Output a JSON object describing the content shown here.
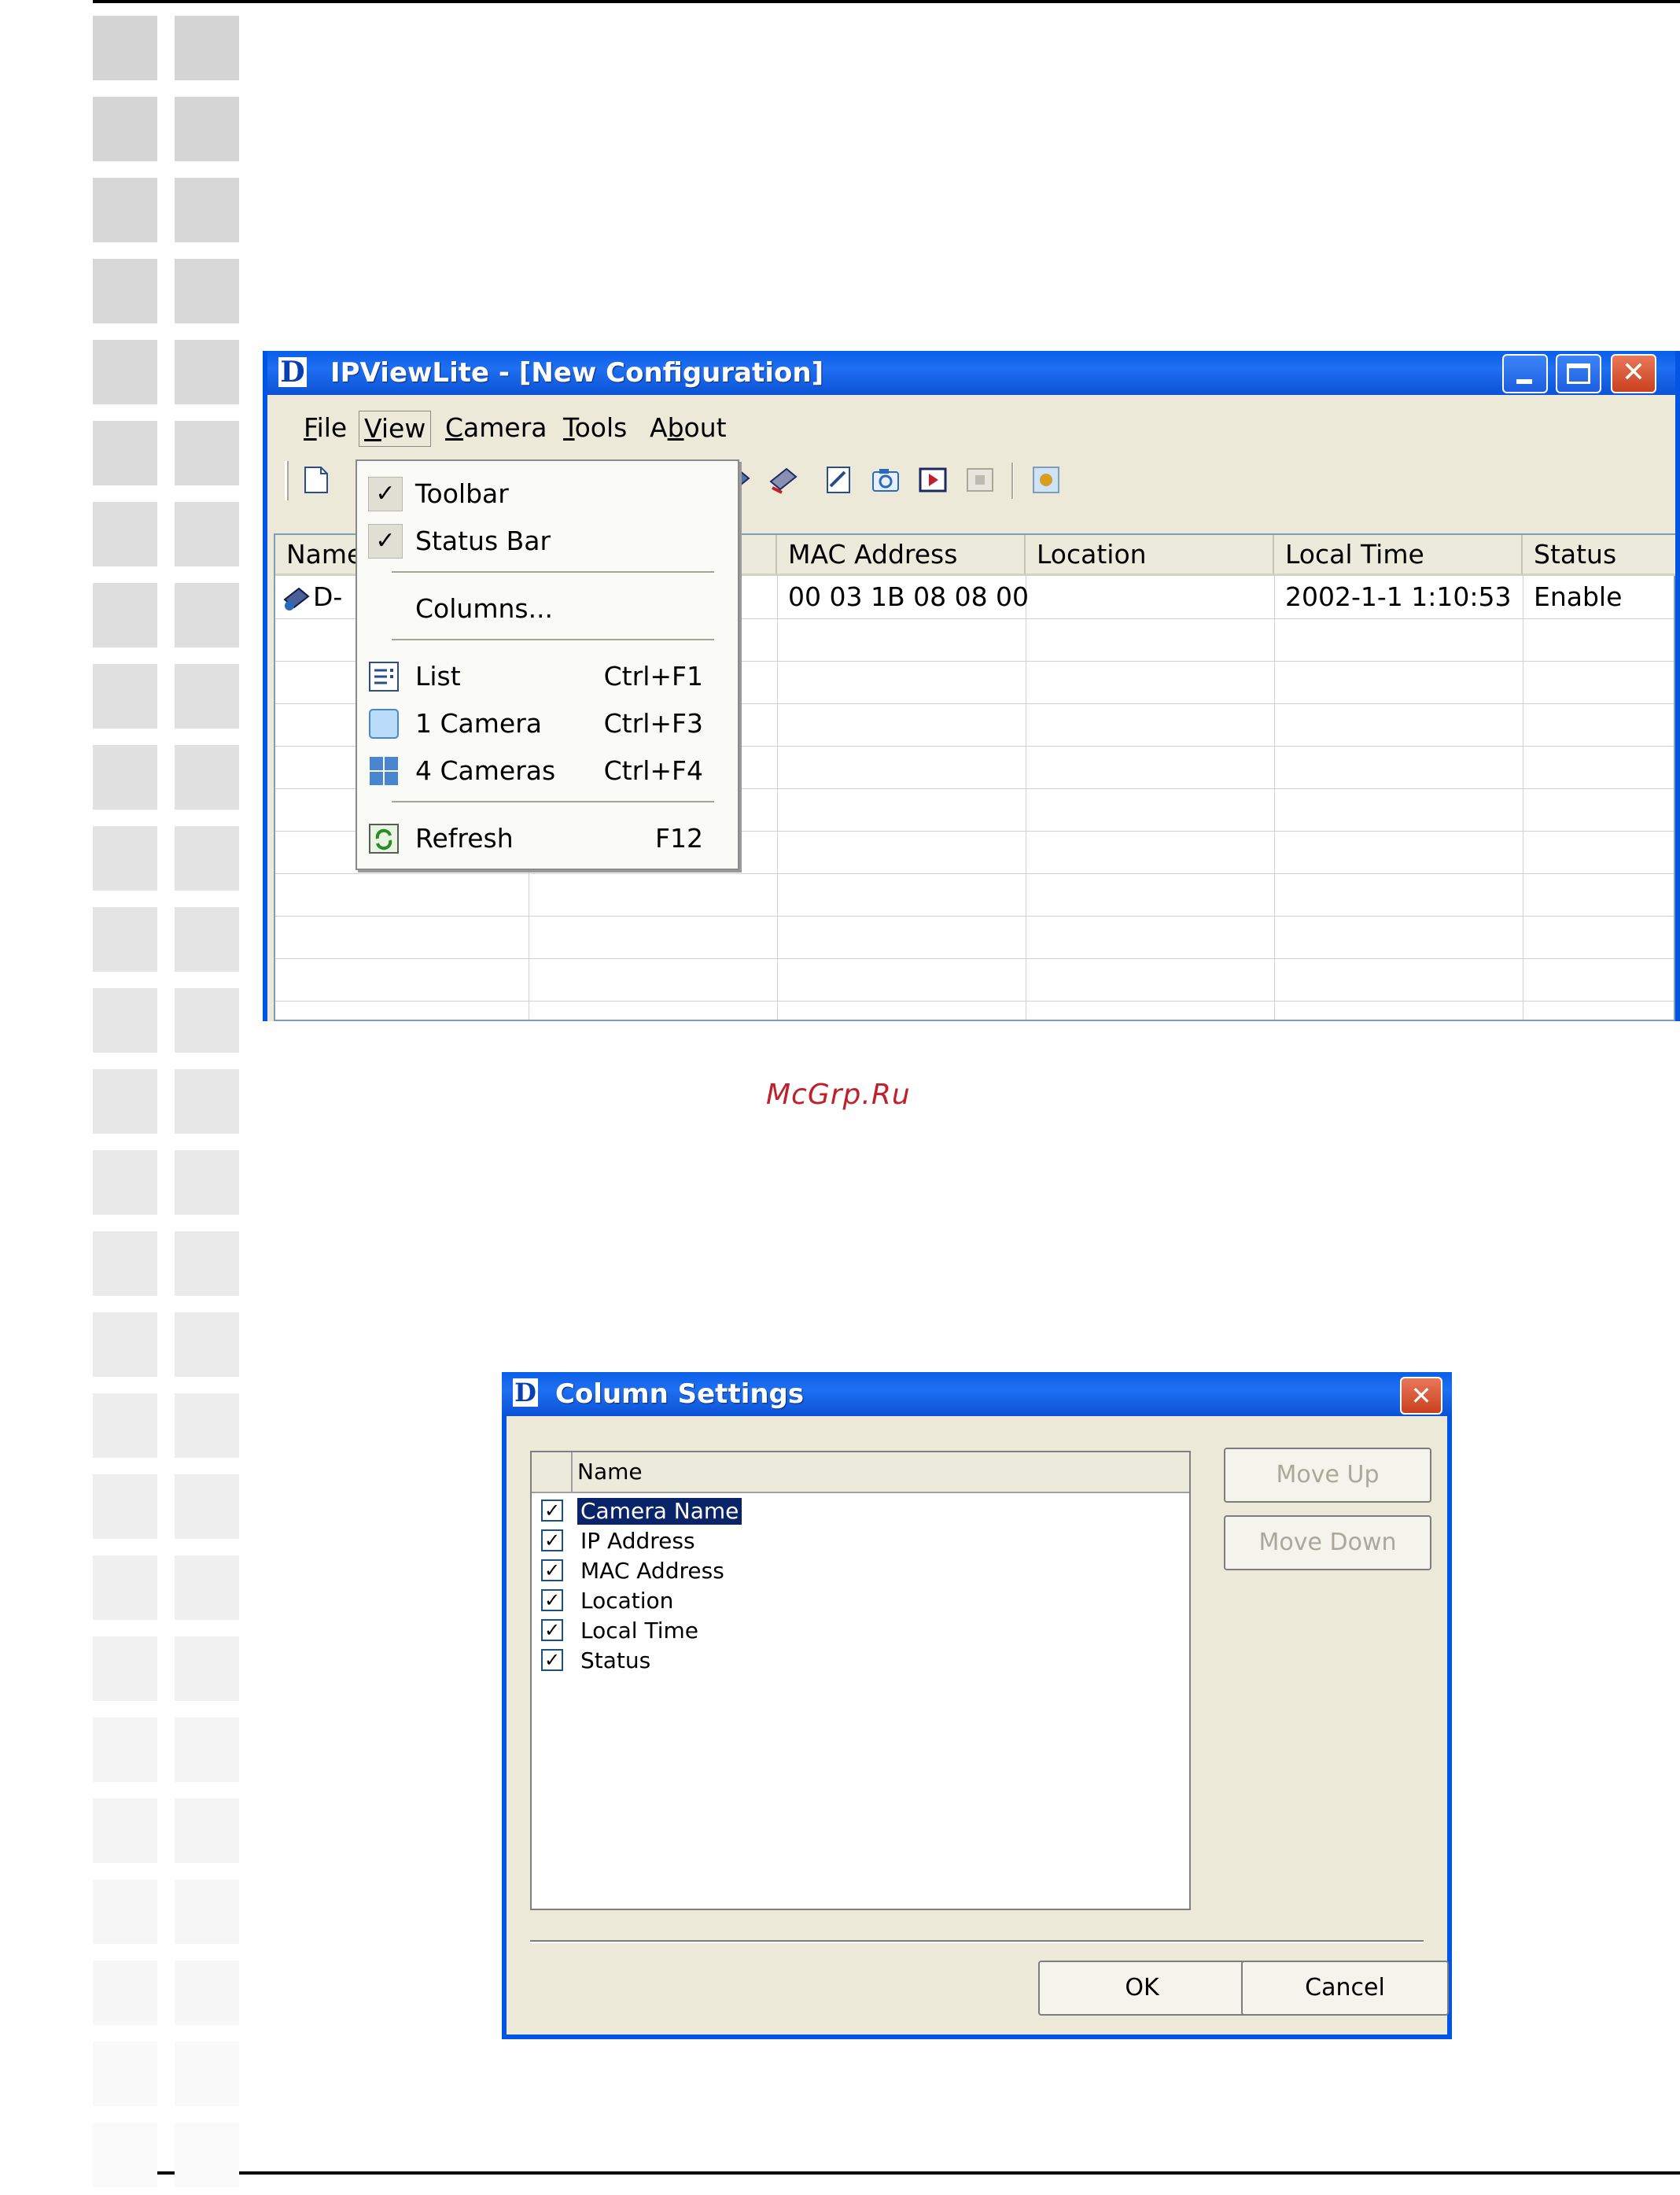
{
  "watermark": "McGrp.Ru",
  "app": {
    "title": "IPViewLite - [New Configuration]",
    "logo_letter": "D",
    "menu": [
      {
        "label": "File",
        "mnemonic": "F"
      },
      {
        "label": "View",
        "mnemonic": "V"
      },
      {
        "label": "Camera",
        "mnemonic": "C"
      },
      {
        "label": "Tools",
        "mnemonic": "T"
      },
      {
        "label": "About",
        "mnemonic": "b"
      }
    ],
    "columns": [
      "Name",
      "",
      "MAC Address",
      "Location",
      "Local Time",
      "Status"
    ],
    "rows": [
      {
        "name": "D-",
        "ip": "",
        "mac": "00 03 1B 08 08 00",
        "location": "",
        "local_time": "2002-1-1  1:10:53",
        "status": "Enable"
      }
    ]
  },
  "view_menu": {
    "toolbar": {
      "label": "Toolbar",
      "checked": true
    },
    "status_bar": {
      "label": "Status Bar",
      "checked": true
    },
    "columns": {
      "label": "Columns..."
    },
    "list": {
      "label": "List",
      "shortcut": "Ctrl+F1"
    },
    "one_camera": {
      "label": "1 Camera",
      "shortcut": "Ctrl+F3"
    },
    "four_cameras": {
      "label": "4 Cameras",
      "shortcut": "Ctrl+F4"
    },
    "refresh": {
      "label": "Refresh",
      "shortcut": "F12"
    },
    "check_glyph": "✓"
  },
  "column_settings": {
    "title": "Column Settings",
    "header": "Name",
    "items": [
      {
        "label": "Camera Name",
        "checked": true,
        "selected": true
      },
      {
        "label": "IP Address",
        "checked": true
      },
      {
        "label": "MAC Address",
        "checked": true
      },
      {
        "label": "Location",
        "checked": true
      },
      {
        "label": "Local Time",
        "checked": true
      },
      {
        "label": "Status",
        "checked": true
      }
    ],
    "check_glyph": "✓",
    "move_up": "Move Up",
    "move_down": "Move Down",
    "ok": "OK",
    "cancel": "Cancel",
    "close_glyph": "✕"
  },
  "colors": {
    "titlebar": "#0a5fe8",
    "window_face": "#ece9d8",
    "selection": "#0a246a",
    "watermark": "#c0202a"
  }
}
